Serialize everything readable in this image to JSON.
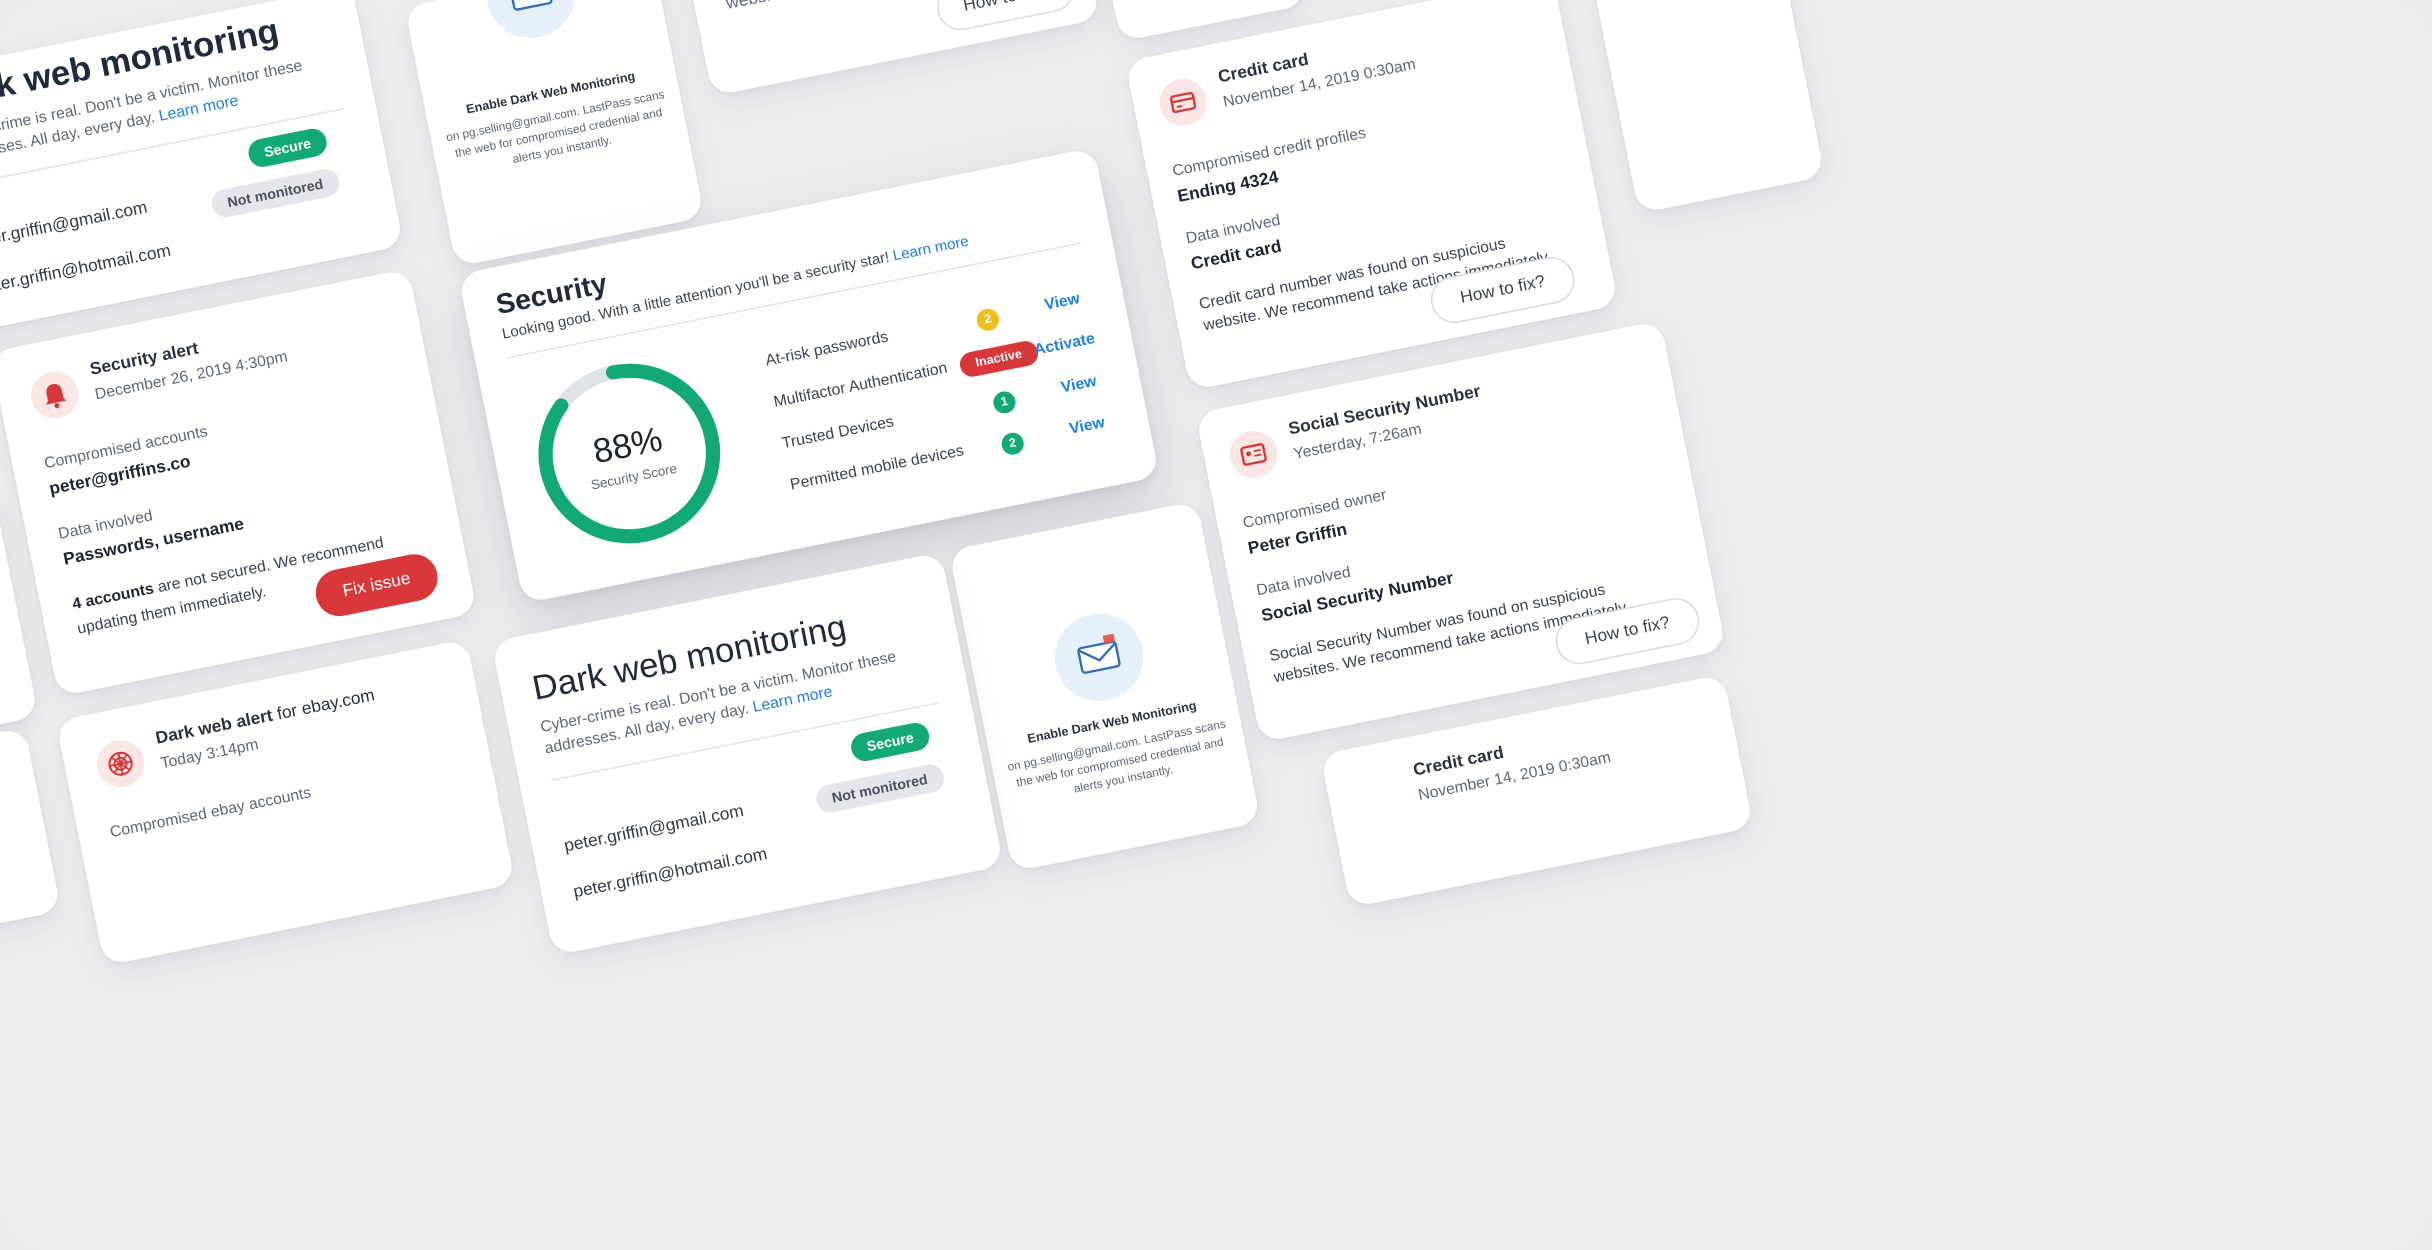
{
  "dark_web_monitoring": {
    "title": "Dark web monitoring",
    "subtitle_line1": "Cyber-crime is real. Don't be a victim. Monitor these",
    "subtitle_line2": "addresses. All day, every day.",
    "learn_more": "Learn more",
    "emails": [
      {
        "address": "peter.griffin@gmail.com",
        "status": "Secure"
      },
      {
        "address": "peter.griffin@hotmail.com",
        "status": "Not monitored"
      }
    ]
  },
  "enable_monitoring": {
    "title": "Enable Dark Web Monitoring",
    "body_line1": "on pg.selling@gmail.com. LastPass scans",
    "body_line2": "the web for compromised credential and",
    "body_line3": "alerts you instantly."
  },
  "security": {
    "title": "Security",
    "subtitle": "Looking good. With a little attention you'll be a security star!",
    "learn_more": "Learn more",
    "score": "88%",
    "score_value": 0.88,
    "score_label": "Security Score",
    "items": [
      {
        "label": "At-risk passwords",
        "badge": "2",
        "action": "View"
      },
      {
        "label": "Multifactor Authentication",
        "badge": "Inactive",
        "action": "Activate"
      },
      {
        "label": "Trusted Devices",
        "badge": "1",
        "action": "View"
      },
      {
        "label": "Permitted mobile devices",
        "badge": "2",
        "action": "View"
      }
    ]
  },
  "credit_card_alert": {
    "title": "Credit card",
    "date": "November 14, 2019 0:30am",
    "label1": "Compromised credit profiles",
    "value1": "Ending 4324",
    "label2": "Data involved",
    "value2": "Credit card",
    "message_line1": "Credit card number was found on suspicious",
    "message_line2": "website. We recommend take actions immediately.",
    "button": "How to fix?"
  },
  "ssn_alert": {
    "title": "Social Security Number",
    "date": "Yesterday, 7:26am",
    "label1": "Compromised owner",
    "value1": "Peter Griffin",
    "label2": "Data involved",
    "value2": "Social Security Number",
    "message_line1": "Social Security Number was found on suspicious",
    "message_line2": "websites. We recommend take actions immediately.",
    "button": "How to fix?"
  },
  "security_alert": {
    "title": "Security alert",
    "date": "December 26, 2019 4:30pm",
    "label1": "Compromised  accounts",
    "value1": "peter@griffins.co",
    "label2": "Data involved",
    "value2": "Passwords, username",
    "message_bold": "4 accounts",
    "message_rest": " are not secured. We recommend",
    "message_line2": "updating them immediately.",
    "button": "Fix issue"
  },
  "ebay_alert": {
    "title": "Dark web alert",
    "title_suffix": " for ebay.com",
    "date": "Today 3:14pm",
    "label1": "Compromised ebay accounts"
  },
  "colors": {
    "green": "#13a877",
    "red": "#d8383a",
    "yellow": "#f2be1a",
    "blue": "#1d7fe0"
  }
}
